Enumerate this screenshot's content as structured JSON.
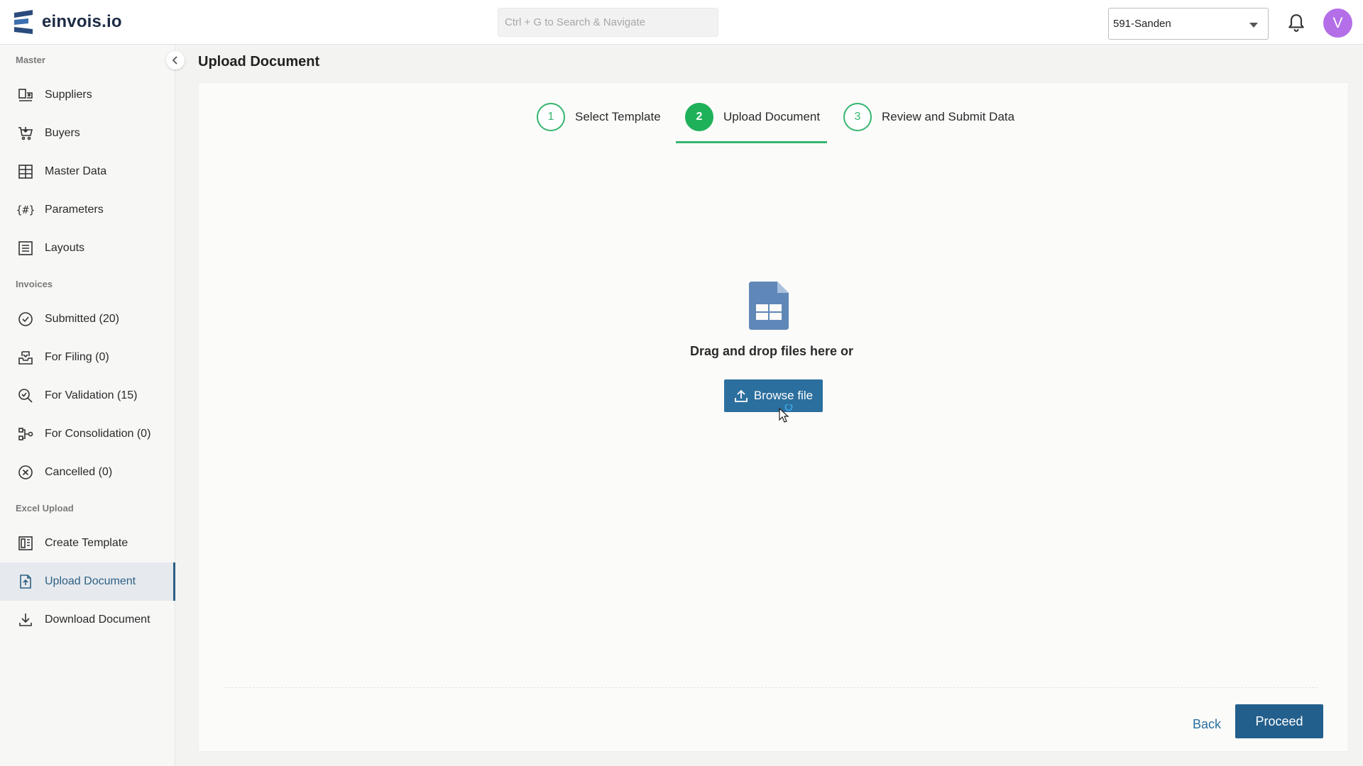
{
  "app": {
    "name": "einvois.io"
  },
  "search": {
    "placeholder": "Ctrl + G to Search & Navigate"
  },
  "company": {
    "selected": "591-Sanden"
  },
  "user": {
    "initial": "V",
    "avatar_color": "#b46fe8"
  },
  "sidebar": {
    "sections": [
      {
        "label": "Master",
        "items": [
          {
            "label": "Suppliers",
            "icon": "supplier-icon"
          },
          {
            "label": "Buyers",
            "icon": "cart-icon"
          },
          {
            "label": "Master Data",
            "icon": "master-data-icon"
          },
          {
            "label": "Parameters",
            "icon": "hash-braces-icon"
          },
          {
            "label": "Layouts",
            "icon": "layout-list-icon"
          }
        ]
      },
      {
        "label": "Invoices",
        "items": [
          {
            "label": "Submitted (20)",
            "icon": "check-circle-icon"
          },
          {
            "label": "For Filing (0)",
            "icon": "inbox-icon"
          },
          {
            "label": "For Validation (15)",
            "icon": "search-check-icon"
          },
          {
            "label": "For Consolidation (0)",
            "icon": "consolidate-icon"
          },
          {
            "label": "Cancelled (0)",
            "icon": "x-circle-icon"
          }
        ]
      },
      {
        "label": "Excel Upload",
        "items": [
          {
            "label": "Create Template",
            "icon": "template-icon"
          },
          {
            "label": "Upload Document",
            "icon": "file-upload-icon",
            "active": true
          },
          {
            "label": "Download Document",
            "icon": "download-icon"
          }
        ]
      }
    ]
  },
  "page": {
    "title": "Upload Document"
  },
  "stepper": {
    "steps": [
      {
        "number": "1",
        "label": "Select Template"
      },
      {
        "number": "2",
        "label": "Upload Document",
        "active": true
      },
      {
        "number": "3",
        "label": "Review and Submit Data"
      }
    ]
  },
  "upload": {
    "drop_text": "Drag and drop files here or",
    "browse_label": "Browse file",
    "icon": "spreadsheet-file-icon"
  },
  "footer": {
    "back_label": "Back",
    "proceed_label": "Proceed"
  },
  "colors": {
    "accent": "#2b6f9e",
    "step_green": "#1fb15a",
    "active_nav": "#2e5f84"
  }
}
